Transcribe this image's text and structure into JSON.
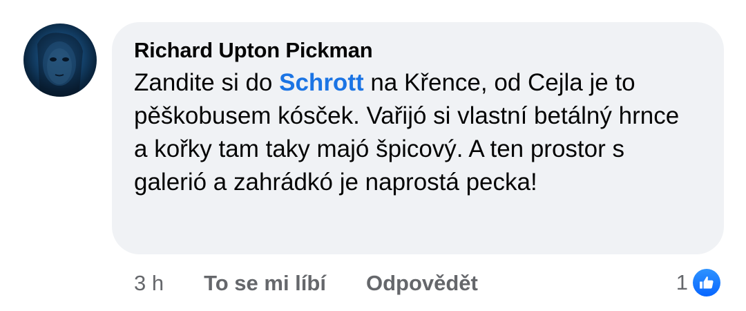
{
  "comment": {
    "author": "Richard Upton Pickman",
    "text_before": "Zandite si do ",
    "mention": "Schrott",
    "text_after": " na Křence, od Cejla je to pěškobusem kósček. Vařijó si vlastní betálný hrnce a kořky tam taky majó špicový. A ten prostor s galerió a zahrádkó je naprostá pecka!",
    "timestamp": "3 h",
    "like_label": "To se mi líbí",
    "reply_label": "Odpovědět",
    "reaction_count": "1",
    "reaction_icon": "thumbs-up-icon"
  },
  "colors": {
    "bubble": "#f0f2f5",
    "mention": "#1b74e4",
    "meta_text": "#65676b",
    "like_badge": "#0866ff"
  }
}
